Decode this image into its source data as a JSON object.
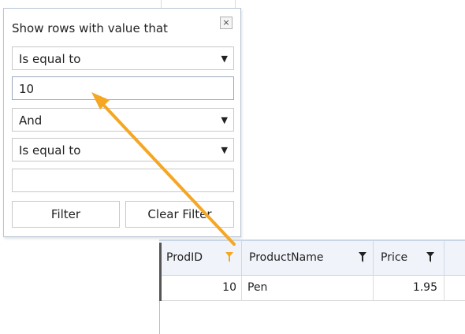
{
  "filter_popup": {
    "title": "Show rows with value that",
    "close_glyph": "×",
    "condition1": {
      "value": "Is equal to"
    },
    "value1": "10",
    "logic": {
      "value": "And"
    },
    "condition2": {
      "value": "Is equal to"
    },
    "value2": "",
    "filter_label": "Filter",
    "clear_filter_label": "Clear Filter"
  },
  "grid": {
    "columns": [
      {
        "label": "ProdID",
        "filter_active": true
      },
      {
        "label": "ProductName",
        "filter_active": false
      },
      {
        "label": "Price",
        "filter_active": false
      }
    ],
    "rows": [
      {
        "ProdID": "10",
        "ProductName": "Pen",
        "Price": "1.95"
      }
    ]
  },
  "colors": {
    "active_filter": "#f5a623",
    "inactive_filter": "#222222",
    "annotation_arrow": "#f5a623"
  }
}
